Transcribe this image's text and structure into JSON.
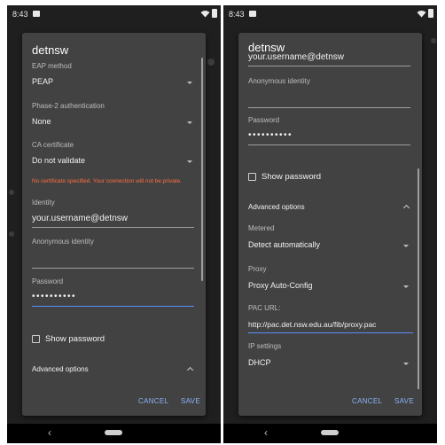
{
  "left_screen": {
    "status_time": "8:43",
    "dialog_title": "detnsw",
    "eap_label": "EAP method",
    "eap_value": "PEAP",
    "phase2_label": "Phase-2 authentication",
    "phase2_value": "None",
    "ca_label": "CA certificate",
    "ca_value": "Do not validate",
    "ca_warning": "No certificate specified. Your connection will not be private.",
    "identity_label": "Identity",
    "identity_value": "your.username@detnsw",
    "anon_label": "Anonymous identity",
    "anon_value": "",
    "password_label": "Password",
    "password_value": "••••••••••",
    "show_password_label": "Show password",
    "advanced_label": "Advanced options",
    "cancel_label": "CANCEL",
    "save_label": "SAVE",
    "nav_back": "‹"
  },
  "right_screen": {
    "status_time": "8:43",
    "dialog_title": "detnsw",
    "identity_value": "your.username@detnsw",
    "anon_label": "Anonymous identity",
    "anon_value": "",
    "password_label": "Password",
    "password_value": "••••••••••",
    "show_password_label": "Show password",
    "advanced_label": "Advanced options",
    "metered_label": "Metered",
    "metered_value": "Detect automatically",
    "proxy_label": "Proxy",
    "proxy_value": "Proxy Auto-Config",
    "pac_label": "PAC URL:",
    "pac_value": "http://pac.det.nsw.edu.au/fib/proxy.pac",
    "ip_label": "IP settings",
    "ip_value": "DHCP",
    "cancel_label": "CANCEL",
    "save_label": "SAVE",
    "nav_back": "‹"
  },
  "colors": {
    "dialog_bg": "#424242",
    "accent": "#8ab4f8",
    "focus_underline": "#5c8cff",
    "warning": "#ff6e40"
  },
  "icons": [
    "notification-icon",
    "wifi-icon",
    "battery-icon",
    "dropdown-arrow-icon",
    "chevron-up-icon",
    "checkbox-icon",
    "nav-back-icon",
    "nav-home-icon"
  ]
}
